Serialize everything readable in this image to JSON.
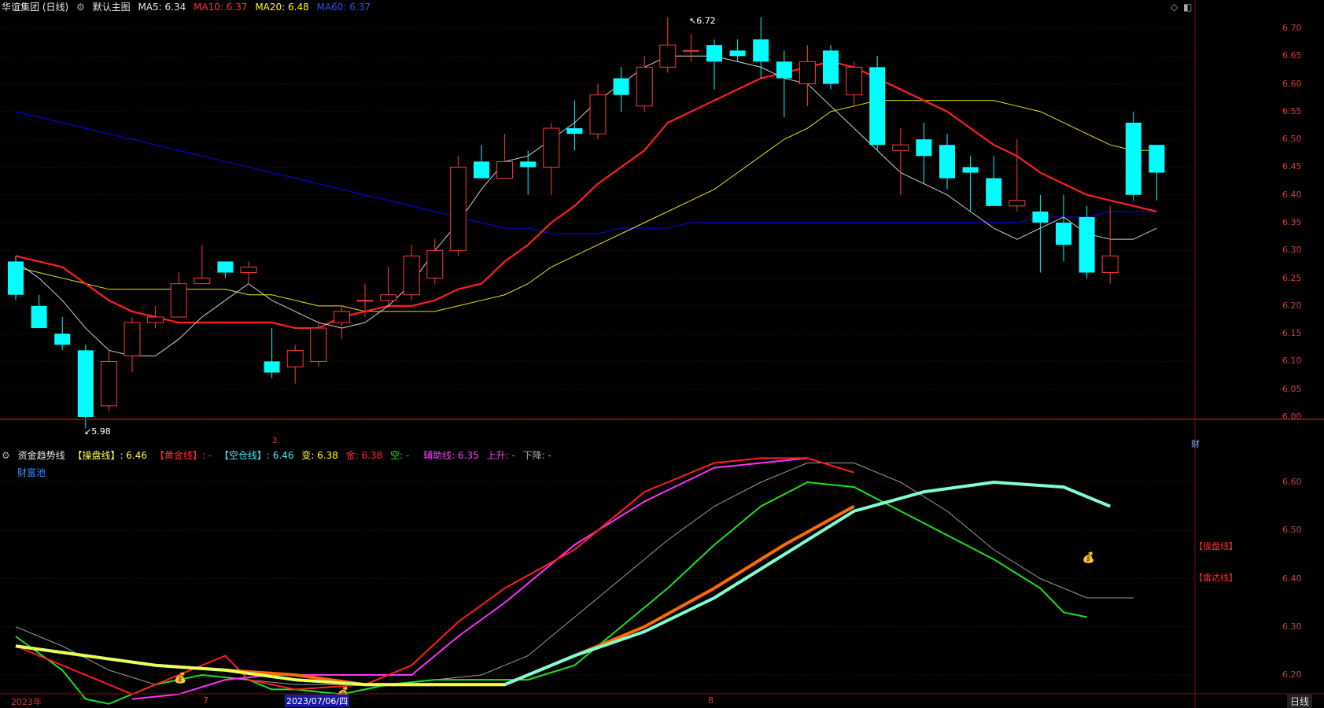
{
  "header": {
    "stock_name": "华谊集团 (日线)",
    "main_chart": "默认主图",
    "ma5": "MA5: 6.34",
    "ma10": "MA10: 6.37",
    "ma20": "MA20: 6.48",
    "ma60": "MA60: 6.37"
  },
  "sub_header": {
    "indicator": "资金趋势线",
    "caopan": "【操盘线】: 6.46",
    "huangjin": "【黄金线】: -",
    "kongcang": "【空仓线】: 6.46",
    "bian": "变: 6.38",
    "jin": "金: 6.38",
    "kong": "空: -",
    "fuzhu": "辅助线: 6.35",
    "shangsheng": "上升: -",
    "xiajiang": "下降: -",
    "caifuchi": "财富池"
  },
  "colors": {
    "up": "#ff3a3a",
    "down": "#00ffff",
    "ma5": "#d0d0d0",
    "ma10": "#ff2020",
    "ma20": "#e6e600",
    "ma60": "#0000ff",
    "axis": "#d23c3c"
  },
  "price_axis": [
    "6.70",
    "6.65",
    "6.60",
    "6.55",
    "6.50",
    "6.45",
    "6.40",
    "6.35",
    "6.30",
    "6.25",
    "6.20",
    "6.15",
    "6.10",
    "6.05",
    "6.00"
  ],
  "sub_axis": [
    "6.60",
    "6.50",
    "6.40",
    "6.30",
    "6.20"
  ],
  "annotations": {
    "high": "6.72",
    "low": "5.98",
    "cai": "财",
    "marker3": "3"
  },
  "sub_tags": {
    "caopan": "【操盘线】",
    "leida": "【雷达线】"
  },
  "x_axis": {
    "start": "2023年",
    "m7": "7",
    "date": "2023/07/06/四",
    "m8": "8"
  },
  "period_button": "日线",
  "chart_data": {
    "type": "candlestick",
    "y_range": [
      5.95,
      6.72
    ],
    "candles": [
      {
        "o": 6.28,
        "h": 6.29,
        "l": 6.21,
        "c": 6.22
      },
      {
        "o": 6.2,
        "h": 6.22,
        "l": 6.16,
        "c": 6.16
      },
      {
        "o": 6.15,
        "h": 6.18,
        "l": 6.12,
        "c": 6.13
      },
      {
        "o": 6.12,
        "h": 6.13,
        "l": 5.98,
        "c": 6.0
      },
      {
        "o": 6.02,
        "h": 6.12,
        "l": 6.01,
        "c": 6.1
      },
      {
        "o": 6.11,
        "h": 6.18,
        "l": 6.08,
        "c": 6.17
      },
      {
        "o": 6.17,
        "h": 6.2,
        "l": 6.16,
        "c": 6.18
      },
      {
        "o": 6.18,
        "h": 6.26,
        "l": 6.18,
        "c": 6.24
      },
      {
        "o": 6.24,
        "h": 6.31,
        "l": 6.24,
        "c": 6.25
      },
      {
        "o": 6.28,
        "h": 6.28,
        "l": 6.25,
        "c": 6.26
      },
      {
        "o": 6.26,
        "h": 6.28,
        "l": 6.24,
        "c": 6.27
      },
      {
        "o": 6.1,
        "h": 6.16,
        "l": 6.07,
        "c": 6.08
      },
      {
        "o": 6.09,
        "h": 6.13,
        "l": 6.06,
        "c": 6.12
      },
      {
        "o": 6.1,
        "h": 6.17,
        "l": 6.09,
        "c": 6.16
      },
      {
        "o": 6.17,
        "h": 6.2,
        "l": 6.14,
        "c": 6.19
      },
      {
        "o": 6.21,
        "h": 6.24,
        "l": 6.18,
        "c": 6.21
      },
      {
        "o": 6.21,
        "h": 6.27,
        "l": 6.2,
        "c": 6.22
      },
      {
        "o": 6.22,
        "h": 6.31,
        "l": 6.21,
        "c": 6.29
      },
      {
        "o": 6.25,
        "h": 6.32,
        "l": 6.24,
        "c": 6.3
      },
      {
        "o": 6.3,
        "h": 6.47,
        "l": 6.29,
        "c": 6.45
      },
      {
        "o": 6.46,
        "h": 6.49,
        "l": 6.43,
        "c": 6.43
      },
      {
        "o": 6.43,
        "h": 6.51,
        "l": 6.43,
        "c": 6.46
      },
      {
        "o": 6.46,
        "h": 6.48,
        "l": 6.4,
        "c": 6.45
      },
      {
        "o": 6.45,
        "h": 6.53,
        "l": 6.4,
        "c": 6.52
      },
      {
        "o": 6.52,
        "h": 6.57,
        "l": 6.48,
        "c": 6.51
      },
      {
        "o": 6.51,
        "h": 6.6,
        "l": 6.5,
        "c": 6.58
      },
      {
        "o": 6.61,
        "h": 6.63,
        "l": 6.55,
        "c": 6.58
      },
      {
        "o": 6.56,
        "h": 6.65,
        "l": 6.55,
        "c": 6.63
      },
      {
        "o": 6.63,
        "h": 6.72,
        "l": 6.62,
        "c": 6.67
      },
      {
        "o": 6.66,
        "h": 6.69,
        "l": 6.64,
        "c": 6.66
      },
      {
        "o": 6.67,
        "h": 6.68,
        "l": 6.59,
        "c": 6.64
      },
      {
        "o": 6.66,
        "h": 6.68,
        "l": 6.64,
        "c": 6.65
      },
      {
        "o": 6.68,
        "h": 6.72,
        "l": 6.61,
        "c": 6.64
      },
      {
        "o": 6.64,
        "h": 6.66,
        "l": 6.54,
        "c": 6.61
      },
      {
        "o": 6.6,
        "h": 6.67,
        "l": 6.56,
        "c": 6.64
      },
      {
        "o": 6.66,
        "h": 6.67,
        "l": 6.59,
        "c": 6.6
      },
      {
        "o": 6.58,
        "h": 6.64,
        "l": 6.56,
        "c": 6.63
      },
      {
        "o": 6.63,
        "h": 6.65,
        "l": 6.48,
        "c": 6.49
      },
      {
        "o": 6.48,
        "h": 6.52,
        "l": 6.4,
        "c": 6.49
      },
      {
        "o": 6.5,
        "h": 6.53,
        "l": 6.42,
        "c": 6.47
      },
      {
        "o": 6.49,
        "h": 6.51,
        "l": 6.41,
        "c": 6.43
      },
      {
        "o": 6.45,
        "h": 6.47,
        "l": 6.37,
        "c": 6.44
      },
      {
        "o": 6.43,
        "h": 6.47,
        "l": 6.38,
        "c": 6.38
      },
      {
        "o": 6.38,
        "h": 6.5,
        "l": 6.37,
        "c": 6.39
      },
      {
        "o": 6.37,
        "h": 6.4,
        "l": 6.26,
        "c": 6.35
      },
      {
        "o": 6.35,
        "h": 6.4,
        "l": 6.28,
        "c": 6.31
      },
      {
        "o": 6.36,
        "h": 6.38,
        "l": 6.25,
        "c": 6.26
      },
      {
        "o": 6.26,
        "h": 6.38,
        "l": 6.24,
        "c": 6.29
      },
      {
        "o": 6.53,
        "h": 6.55,
        "l": 6.39,
        "c": 6.4
      },
      {
        "o": 6.49,
        "h": 6.49,
        "l": 6.39,
        "c": 6.44
      }
    ],
    "ma5": [
      6.28,
      6.25,
      6.21,
      6.16,
      6.12,
      6.11,
      6.11,
      6.14,
      6.18,
      6.21,
      6.24,
      6.21,
      6.19,
      6.17,
      6.16,
      6.17,
      6.2,
      6.24,
      6.3,
      6.35,
      6.41,
      6.46,
      6.47,
      6.5,
      6.53,
      6.57,
      6.6,
      6.63,
      6.65,
      6.65,
      6.65,
      6.64,
      6.63,
      6.61,
      6.6,
      6.56,
      6.52,
      6.48,
      6.44,
      6.42,
      6.4,
      6.37,
      6.34,
      6.32,
      6.34,
      6.36,
      6.33,
      6.32,
      6.32,
      6.34
    ],
    "ma10": [
      6.29,
      6.28,
      6.27,
      6.24,
      6.21,
      6.19,
      6.18,
      6.17,
      6.17,
      6.17,
      6.17,
      6.17,
      6.16,
      6.16,
      6.18,
      6.19,
      6.2,
      6.2,
      6.21,
      6.23,
      6.24,
      6.28,
      6.31,
      6.35,
      6.38,
      6.42,
      6.45,
      6.48,
      6.53,
      6.55,
      6.57,
      6.59,
      6.61,
      6.62,
      6.63,
      6.64,
      6.63,
      6.61,
      6.59,
      6.57,
      6.55,
      6.52,
      6.49,
      6.47,
      6.44,
      6.42,
      6.4,
      6.39,
      6.38,
      6.37
    ],
    "ma20": [
      6.27,
      6.26,
      6.25,
      6.24,
      6.23,
      6.23,
      6.23,
      6.23,
      6.23,
      6.23,
      6.22,
      6.22,
      6.21,
      6.2,
      6.2,
      6.19,
      6.19,
      6.19,
      6.19,
      6.2,
      6.21,
      6.22,
      6.24,
      6.27,
      6.29,
      6.31,
      6.33,
      6.35,
      6.37,
      6.39,
      6.41,
      6.44,
      6.47,
      6.5,
      6.52,
      6.55,
      6.56,
      6.57,
      6.57,
      6.57,
      6.57,
      6.57,
      6.57,
      6.56,
      6.55,
      6.53,
      6.51,
      6.49,
      6.48,
      6.48
    ],
    "ma60": [
      6.55,
      6.54,
      6.53,
      6.52,
      6.51,
      6.5,
      6.49,
      6.48,
      6.47,
      6.46,
      6.45,
      6.44,
      6.43,
      6.42,
      6.41,
      6.4,
      6.39,
      6.38,
      6.37,
      6.36,
      6.35,
      6.34,
      6.34,
      6.33,
      6.33,
      6.33,
      6.34,
      6.34,
      6.34,
      6.35,
      6.35,
      6.35,
      6.35,
      6.35,
      6.35,
      6.35,
      6.35,
      6.35,
      6.35,
      6.35,
      6.35,
      6.35,
      6.35,
      6.35,
      6.36,
      6.36,
      6.36,
      6.37,
      6.37,
      6.37
    ],
    "sub_y_range": [
      6.15,
      6.66
    ],
    "sub_series": {
      "caopan_x": [
        0,
        3,
        6,
        9,
        12,
        15,
        18,
        21,
        24,
        27,
        30,
        33,
        36,
        39,
        42,
        45,
        47
      ],
      "caopan_y": [
        6.26,
        6.24,
        6.22,
        6.21,
        6.19,
        6.18,
        6.18,
        6.18,
        6.24,
        6.29,
        6.36,
        6.45,
        6.54,
        6.58,
        6.6,
        6.59,
        6.55
      ],
      "huangjin_x": [
        0,
        3,
        6,
        9,
        12,
        15,
        18,
        21,
        24,
        27,
        30,
        33,
        36
      ],
      "huangjin_y": [
        6.26,
        6.24,
        6.22,
        6.21,
        6.2,
        6.18,
        6.18,
        6.18,
        6.24,
        6.3,
        6.38,
        6.47,
        6.55
      ],
      "red_x": [
        0,
        5,
        9,
        10,
        12,
        15,
        17,
        19,
        21,
        24,
        27,
        30,
        32,
        34,
        36
      ],
      "red_y": [
        6.26,
        6.16,
        6.24,
        6.19,
        6.17,
        6.18,
        6.22,
        6.31,
        6.38,
        6.46,
        6.58,
        6.64,
        6.65,
        6.65,
        6.62
      ],
      "magenta_x": [
        5,
        7,
        9,
        11,
        14,
        17,
        19,
        21,
        24,
        27,
        30,
        32,
        34
      ],
      "magenta_y": [
        6.15,
        6.16,
        6.19,
        6.2,
        6.2,
        6.2,
        6.28,
        6.35,
        6.47,
        6.56,
        6.63,
        6.64,
        6.65
      ],
      "green_x": [
        0,
        2,
        3,
        4,
        5,
        6,
        8,
        10,
        11,
        12,
        14,
        16,
        18,
        20,
        22,
        24,
        26,
        28,
        30,
        32,
        34,
        36,
        38,
        40,
        42,
        44,
        45,
        46
      ],
      "green_y": [
        6.28,
        6.21,
        6.15,
        6.14,
        6.16,
        6.18,
        6.2,
        6.19,
        6.17,
        6.17,
        6.16,
        6.18,
        6.19,
        6.19,
        6.19,
        6.22,
        6.3,
        6.38,
        6.47,
        6.55,
        6.6,
        6.59,
        6.54,
        6.49,
        6.44,
        6.38,
        6.33,
        6.32
      ],
      "gray_x": [
        0,
        2,
        4,
        6,
        8,
        10,
        12,
        14,
        16,
        18,
        20,
        22,
        24,
        26,
        28,
        30,
        32,
        34,
        36,
        38,
        40,
        42,
        44,
        46,
        48
      ],
      "gray_y": [
        6.3,
        6.26,
        6.21,
        6.18,
        6.2,
        6.19,
        6.18,
        6.18,
        6.18,
        6.19,
        6.2,
        6.24,
        6.32,
        6.4,
        6.48,
        6.55,
        6.6,
        6.64,
        6.64,
        6.6,
        6.54,
        6.46,
        6.4,
        6.36,
        6.36
      ]
    }
  }
}
